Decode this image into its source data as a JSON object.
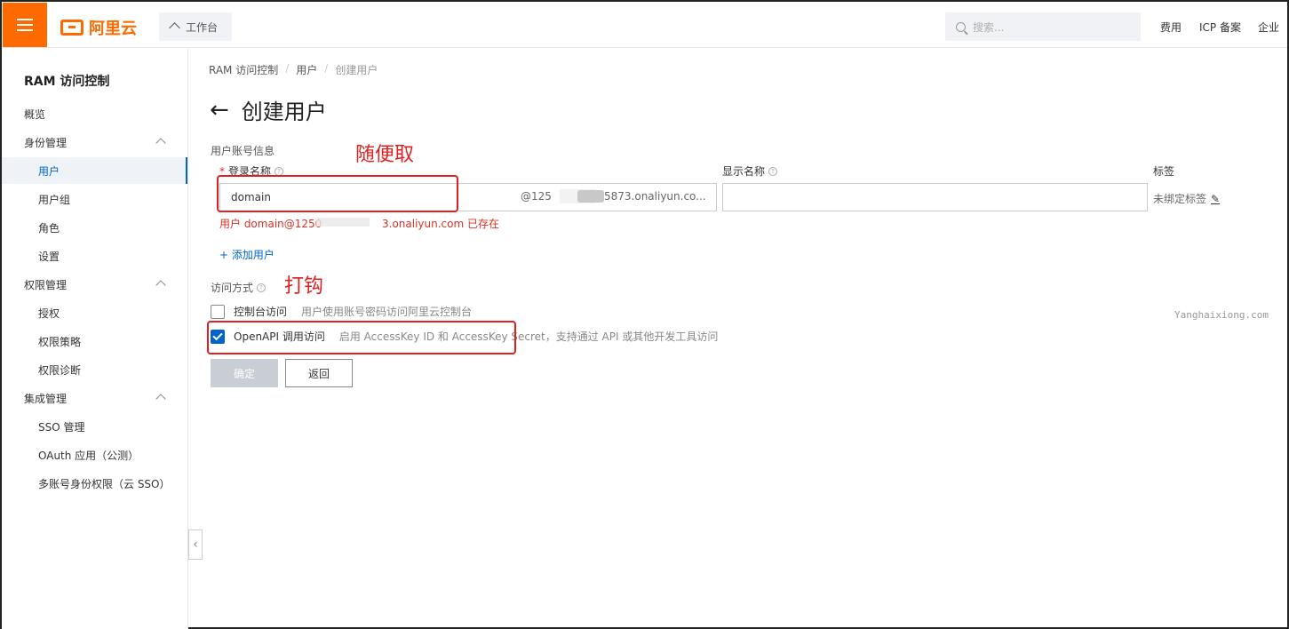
{
  "topbar": {
    "logo_text": "阿里云",
    "workbench": "工作台",
    "search_placeholder": "搜索...",
    "links": [
      "费用",
      "ICP 备案",
      "企业"
    ]
  },
  "sidebar": {
    "title": "RAM 访问控制",
    "items": [
      {
        "label": "概览"
      },
      {
        "label": "身份管理"
      },
      {
        "label": "用户"
      },
      {
        "label": "用户组"
      },
      {
        "label": "角色"
      },
      {
        "label": "设置"
      },
      {
        "label": "权限管理"
      },
      {
        "label": "授权"
      },
      {
        "label": "权限策略"
      },
      {
        "label": "权限诊断"
      },
      {
        "label": "集成管理"
      },
      {
        "label": "SSO 管理"
      },
      {
        "label": "OAuth 应用（公测）"
      },
      {
        "label": "多账号身份权限（云 SSO）"
      }
    ]
  },
  "breadcrumb": [
    "RAM 访问控制",
    "用户",
    "创建用户"
  ],
  "page": {
    "title": "创建用户",
    "section_account": "用户账号信息",
    "login_name_label": "登录名称",
    "login_name_value": "domain",
    "login_name_suffix_a": "@125",
    "login_name_suffix_b": "5873.onaliyun.co...",
    "display_name_label": "显示名称",
    "display_name_value": "",
    "tags_label": "标签",
    "tags_value": "未绑定标签",
    "error_a": "用户 domain@1250",
    "error_b": "3.onaliyun.com 已存在",
    "add_user": "+ 添加用户",
    "access_label": "访问方式",
    "console_access_label": "控制台访问",
    "console_access_desc": "用户使用账号密码访问阿里云控制台",
    "openapi_label": "OpenAPI 调用访问",
    "openapi_desc": "启用 AccessKey ID 和 AccessKey Secret，支持通过 API 或其他开发工具访问",
    "ok_button": "确定",
    "back_button": "返回"
  },
  "annotations": {
    "name_note": "随便取",
    "check_note": "打钩"
  },
  "watermark": "Yanghaixiong.com"
}
